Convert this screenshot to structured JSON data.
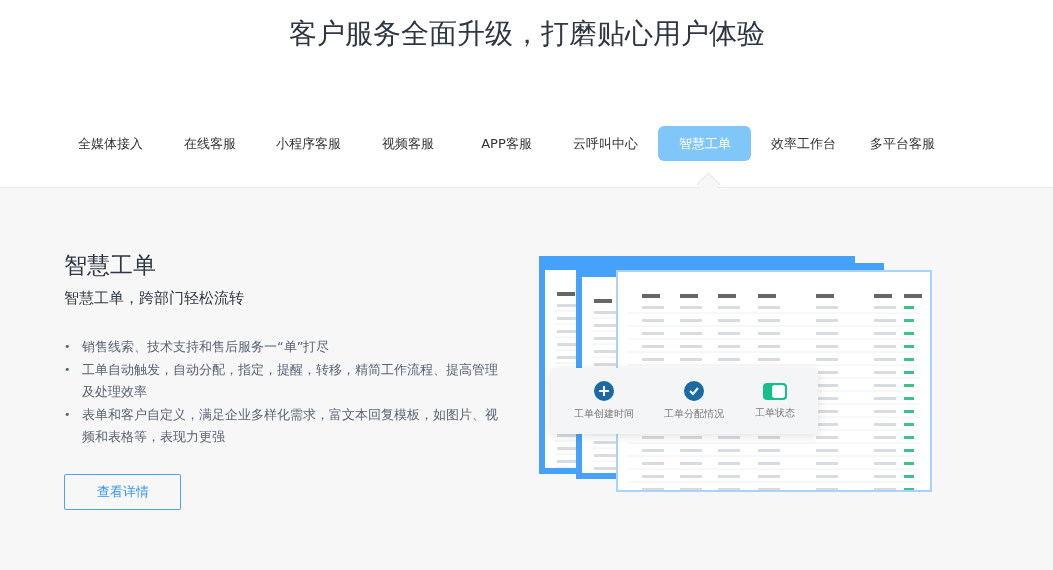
{
  "title": "客户服务全面升级，打磨贴心用户体验",
  "tabs": [
    {
      "label": "全媒体接入",
      "selected": false
    },
    {
      "label": "在线客服",
      "selected": false
    },
    {
      "label": "小程序客服",
      "selected": false
    },
    {
      "label": "视频客服",
      "selected": false
    },
    {
      "label": "APP客服",
      "selected": false
    },
    {
      "label": "云呼叫中心",
      "selected": false
    },
    {
      "label": "智慧工单",
      "selected": true
    },
    {
      "label": "效率工作台",
      "selected": false
    },
    {
      "label": "多平台客服",
      "selected": false
    }
  ],
  "feature": {
    "heading": "智慧工单",
    "subtitle": "智慧工单，跨部门轻松流转",
    "bullets": [
      {
        "marker": "•",
        "text": "销售线索、技术支持和售后服务一“单”打尽"
      },
      {
        "marker": "•",
        "text": "工单自动触发，自动分配，指定，提醒，转移，精简工作流程、提高管理及处理效率"
      },
      {
        "marker": "•",
        "text": "表单和客户自定义，满足企业多样化需求，富文本回复模板，如图片、视频和表格等，表现力更强"
      }
    ],
    "button": "查看详情"
  },
  "illustration": {
    "badges": [
      {
        "kind": "plus",
        "label": "工单创建时间"
      },
      {
        "kind": "check",
        "label": "工单分配情况"
      },
      {
        "kind": "toggle",
        "label": "工单状态"
      }
    ]
  }
}
